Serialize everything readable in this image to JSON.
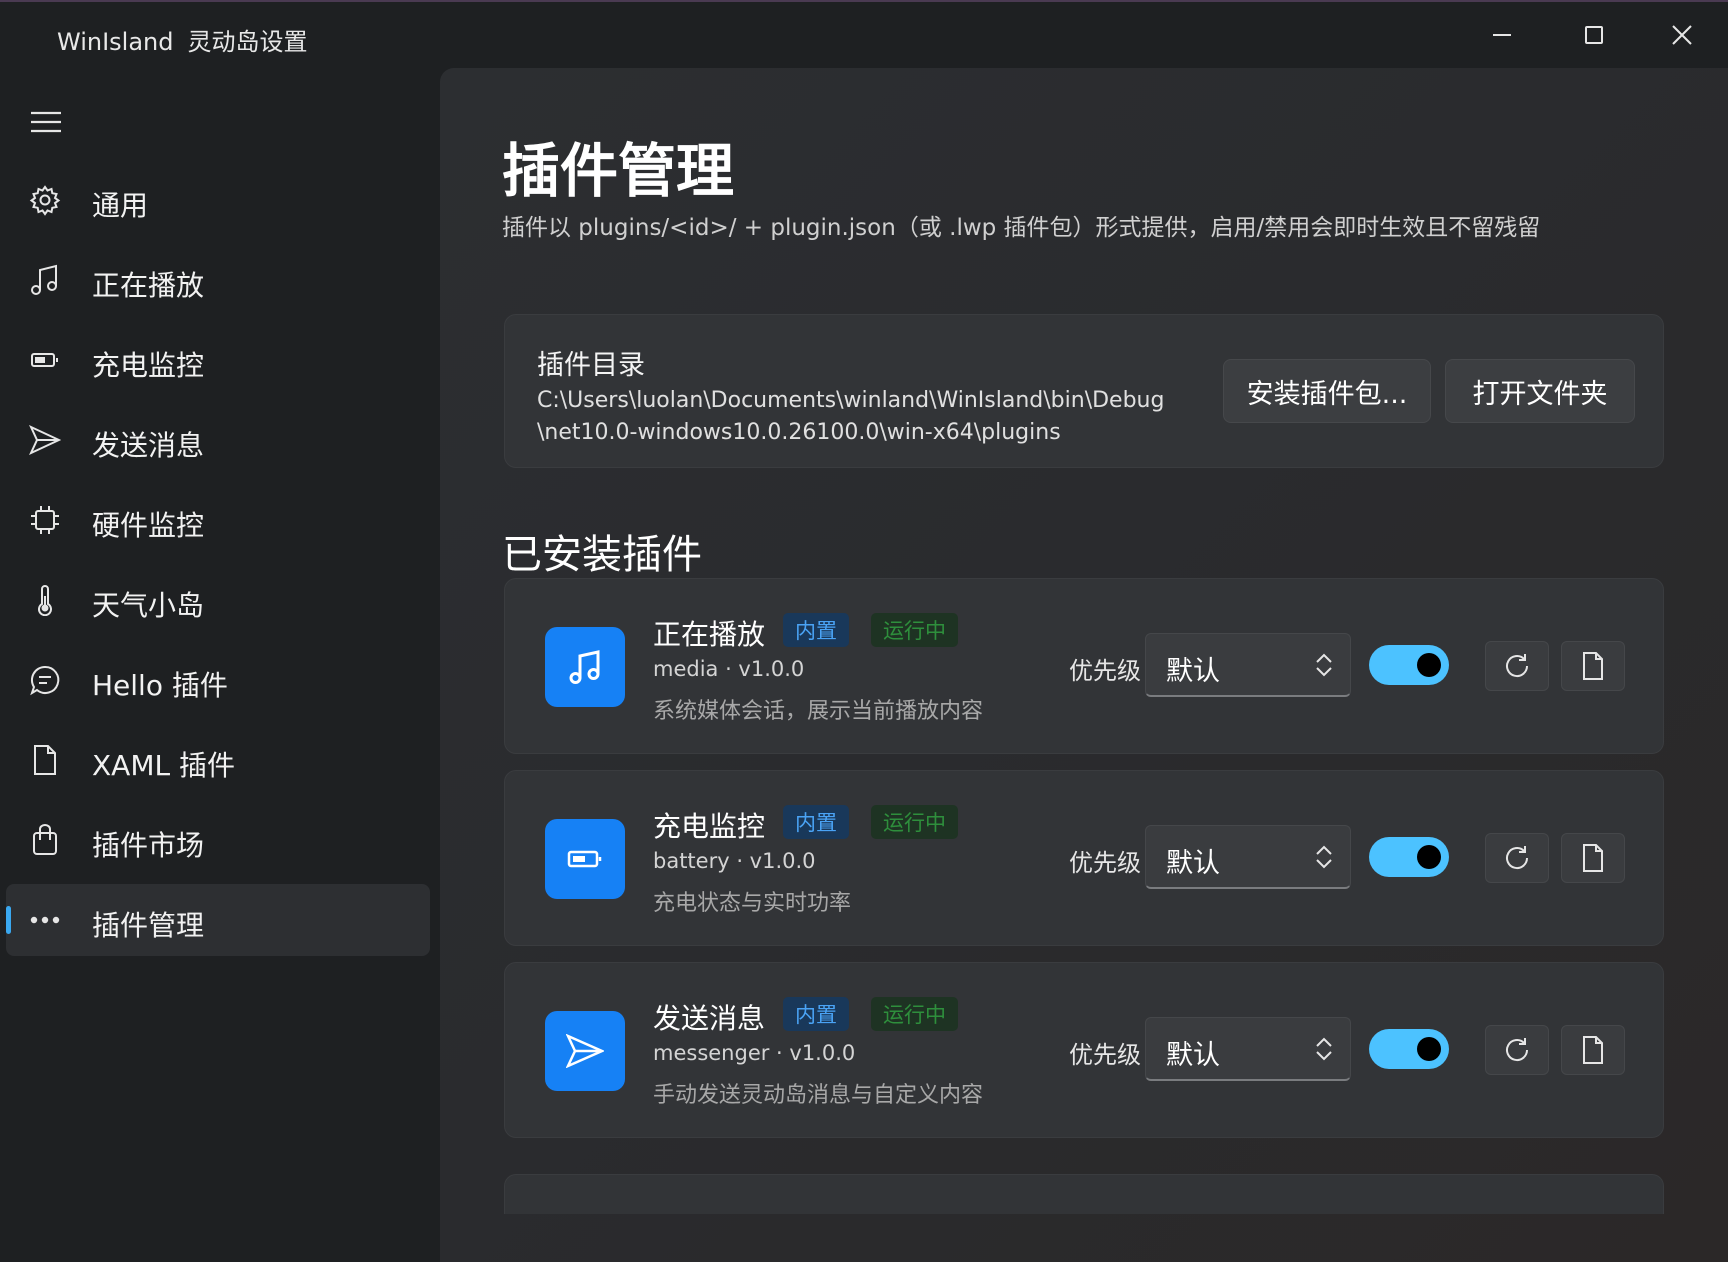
{
  "window": {
    "title": "WinIsland",
    "subtitle": "灵动岛设置",
    "controls": [
      "minimize-icon",
      "maximize-icon",
      "close-icon"
    ]
  },
  "sidebar": {
    "menu_icon": "hamburger-icon",
    "items": [
      {
        "label": "通用",
        "icon": "gear-icon",
        "selected": false
      },
      {
        "label": "正在播放",
        "icon": "music-note-icon",
        "selected": false
      },
      {
        "label": "充电监控",
        "icon": "battery-icon",
        "selected": false
      },
      {
        "label": "发送消息",
        "icon": "send-icon",
        "selected": false
      },
      {
        "label": "硬件监控",
        "icon": "chip-icon",
        "selected": false
      },
      {
        "label": "天气小岛",
        "icon": "thermometer-icon",
        "selected": false
      },
      {
        "label": "Hello 插件",
        "icon": "chat-bubble-icon",
        "selected": false
      },
      {
        "label": "XAML 插件",
        "icon": "document-icon",
        "selected": false
      },
      {
        "label": "插件市场",
        "icon": "shopping-bag-icon",
        "selected": false
      },
      {
        "label": "插件管理",
        "icon": "more-dots-icon",
        "selected": true
      }
    ]
  },
  "main": {
    "title": "插件管理",
    "description": "插件以 plugins/<id>/ + plugin.json（或 .lwp 插件包）形式提供，启用/禁用会即时生效且不留残留",
    "directory": {
      "label": "插件目录",
      "path_line1": "C:\\Users\\luolan\\Documents\\winland\\WinIsland\\bin\\Debug",
      "path_line2": "\\net10.0-windows10.0.26100.0\\win-x64\\plugins",
      "install_button": "安装插件包...",
      "open_button": "打开文件夹"
    },
    "installed_title": "已安装插件",
    "priority_label": "优先级",
    "plugins": [
      {
        "name": "正在播放",
        "badge_builtin": "内置",
        "badge_status": "运行中",
        "meta": "media · v1.0.0",
        "description": "系统媒体会话，展示当前播放内容",
        "priority": "默认",
        "enabled": true,
        "icon": "music-note-icon"
      },
      {
        "name": "充电监控",
        "badge_builtin": "内置",
        "badge_status": "运行中",
        "meta": "battery · v1.0.0",
        "description": "充电状态与实时功率",
        "priority": "默认",
        "enabled": true,
        "icon": "battery-icon"
      },
      {
        "name": "发送消息",
        "badge_builtin": "内置",
        "badge_status": "运行中",
        "meta": "messenger · v1.0.0",
        "description": "手动发送灵动岛消息与自定义内容",
        "priority": "默认",
        "enabled": true,
        "icon": "send-icon"
      }
    ],
    "colors": {
      "accent": "#1681f5",
      "toggle_on": "#4cc2ff",
      "badge_builtin": "#4aa3f5",
      "badge_running": "#2e8f3c"
    }
  }
}
